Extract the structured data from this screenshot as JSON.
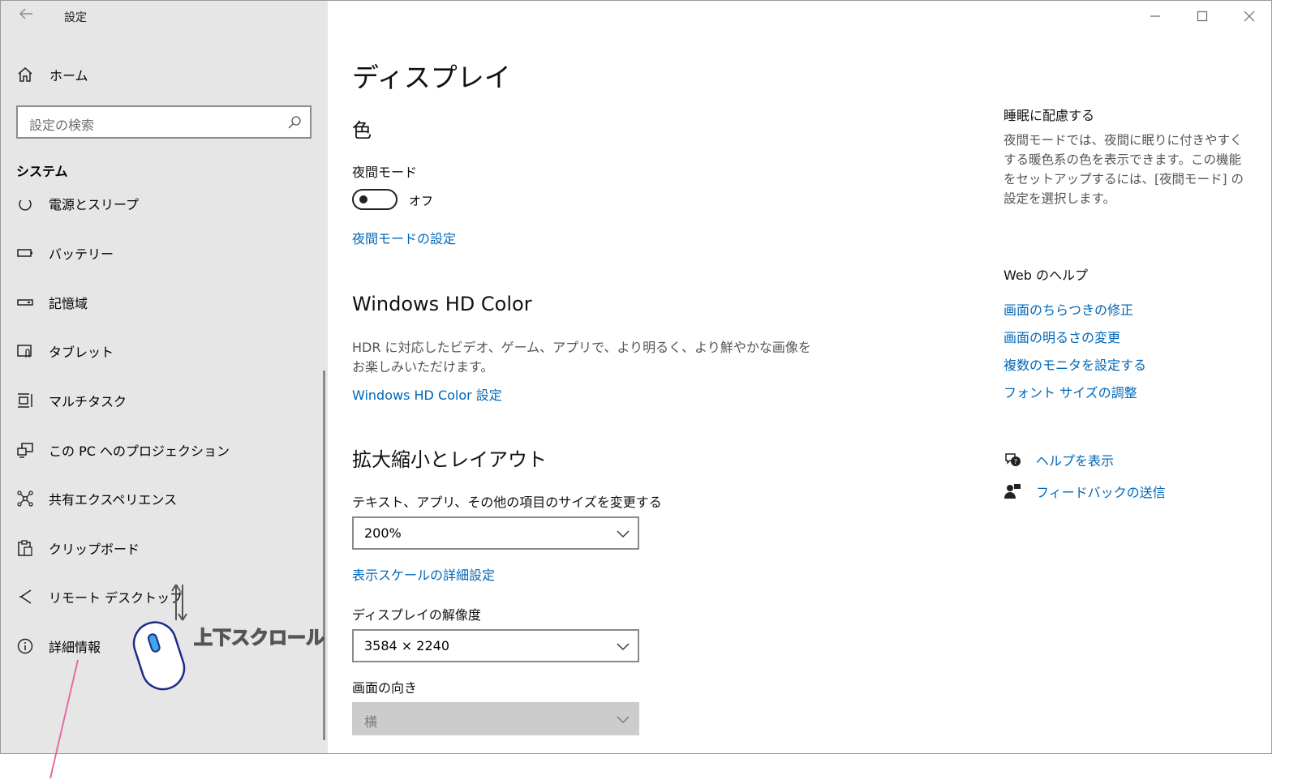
{
  "window": {
    "title": "設定"
  },
  "sidebar": {
    "home_label": "ホーム",
    "search_placeholder": "設定の検索",
    "section_title": "システム",
    "items": [
      {
        "label": "電源とスリープ",
        "icon": "power-icon"
      },
      {
        "label": "バッテリー",
        "icon": "battery-icon"
      },
      {
        "label": "記憶域",
        "icon": "storage-icon"
      },
      {
        "label": "タブレット",
        "icon": "tablet-icon"
      },
      {
        "label": "マルチタスク",
        "icon": "multitask-icon"
      },
      {
        "label": "この PC へのプロジェクション",
        "icon": "projection-icon"
      },
      {
        "label": "共有エクスペリエンス",
        "icon": "shared-experiences-icon"
      },
      {
        "label": "クリップボード",
        "icon": "clipboard-icon"
      },
      {
        "label": "リモート デスクトップ",
        "icon": "remote-desktop-icon"
      },
      {
        "label": "詳細情報",
        "icon": "info-icon"
      }
    ]
  },
  "annotation": {
    "scroll_text": "上下スクロール"
  },
  "main": {
    "page_title": "ディスプレイ",
    "color_section": {
      "heading": "色",
      "night_light_label": "夜間モード",
      "toggle_state": "オフ",
      "night_light_settings_link": "夜間モードの設定"
    },
    "hdr_section": {
      "heading": "Windows HD Color",
      "description": "HDR に対応したビデオ、ゲーム、アプリで、より明るく、より鮮やかな画像をお楽しみいただけます。",
      "settings_link": "Windows HD Color 設定"
    },
    "scale_section": {
      "heading": "拡大縮小とレイアウト",
      "scale_label": "テキスト、アプリ、その他の項目のサイズを変更する",
      "scale_value": "200%",
      "advanced_scale_link": "表示スケールの詳細設定",
      "resolution_label": "ディスプレイの解像度",
      "resolution_value": "3584 × 2240",
      "orientation_label": "画面の向き",
      "orientation_value": "横"
    }
  },
  "right_panel": {
    "sleep_title": "睡眠に配慮する",
    "sleep_desc": "夜間モードでは、夜間に眠りに付きやすくする暖色系の色を表示できます。この機能をセットアップするには、[夜間モード] の設定を選択します。",
    "web_help_title": "Web のヘルプ",
    "help_links": [
      "画面のちらつきの修正",
      "画面の明るさの変更",
      "複数のモニタを設定する",
      "フォント サイズの調整"
    ],
    "get_help": "ヘルプを表示",
    "send_feedback": "フィードバックの送信"
  },
  "colors": {
    "accent": "#0067b8",
    "sidebar_bg": "#e6e6e6",
    "annotation_pink": "#e86aa6",
    "mouse_blue": "#1c2b8c"
  }
}
